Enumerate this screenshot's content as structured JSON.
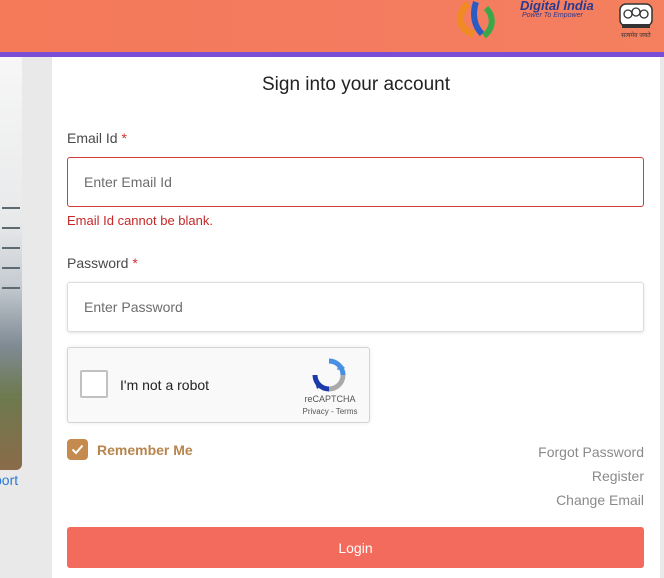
{
  "header": {
    "brand_name": "Digital India",
    "brand_tagline": "Power To Empower",
    "emblem_caption": "सत्यमेव जयते",
    "colors": {
      "bar": "#f47a5a",
      "border": "#7a4fd6"
    }
  },
  "left": {
    "support_link": "port"
  },
  "form": {
    "title": "Sign into your account",
    "email_label": "Email Id",
    "email_placeholder": "Enter Email Id",
    "email_error": "Email Id cannot be blank.",
    "password_label": "Password",
    "password_placeholder": "Enter Password",
    "required_mark": "*",
    "remember_label": "Remember Me",
    "remember_checked": true,
    "forgot_password": "Forgot Password",
    "register": "Register",
    "change_email": "Change Email",
    "login_label": "Login"
  },
  "captcha": {
    "label": "I'm not a robot",
    "brand": "reCAPTCHA",
    "terms": "Privacy - Terms"
  }
}
